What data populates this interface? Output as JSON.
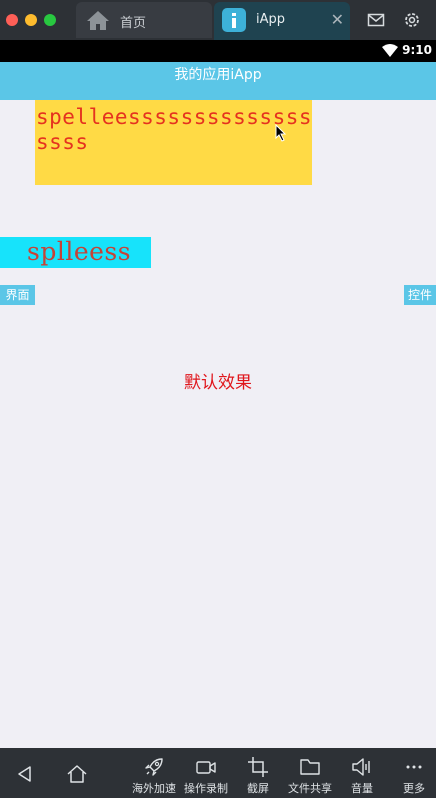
{
  "window": {
    "tabs": [
      {
        "label": "首页"
      },
      {
        "label": "iApp"
      }
    ]
  },
  "status": {
    "time": "9:10"
  },
  "app": {
    "title": "我的应用iApp",
    "yellow_text": "spelleessssssssssssssssss",
    "cyan_text": "splleess",
    "left_button": "界面",
    "right_button": "控件",
    "effect_text": "默认效果"
  },
  "bottom_toolbar": {
    "items": [
      {
        "label": "海外加速",
        "icon": "rocket-icon"
      },
      {
        "label": "操作录制",
        "icon": "video-icon"
      },
      {
        "label": "截屏",
        "icon": "crop-icon"
      },
      {
        "label": "文件共享",
        "icon": "folder-icon"
      },
      {
        "label": "音量",
        "icon": "volume-icon"
      },
      {
        "label": "更多",
        "icon": "more-icon"
      }
    ]
  },
  "colors": {
    "appbar": "#5bc6e7",
    "yellow": "#ffda45",
    "cyan": "#17e3fb",
    "red_text": "#e0161c"
  }
}
